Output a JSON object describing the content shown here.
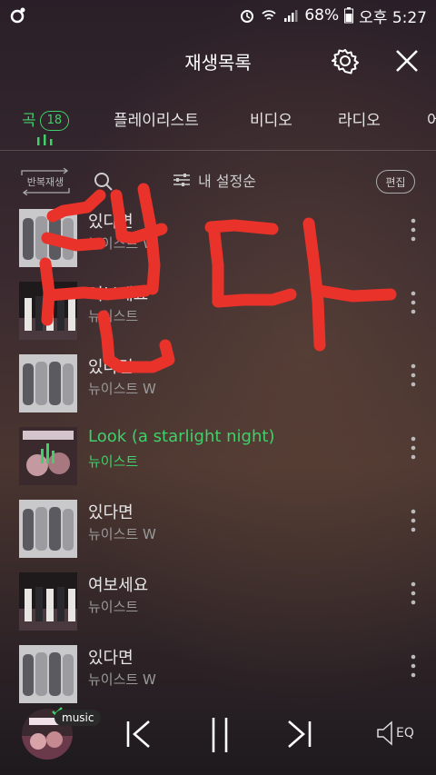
{
  "status_bar": {
    "battery_percent": "68%",
    "time": "오후 5:27"
  },
  "header": {
    "title": "재생목록"
  },
  "tabs": [
    {
      "label": "곡",
      "badge": "18",
      "active": true
    },
    {
      "label": "플레이리스트",
      "active": false
    },
    {
      "label": "비디오",
      "active": false
    },
    {
      "label": "라디오",
      "active": false
    },
    {
      "label": "어",
      "active": false
    }
  ],
  "toolbar": {
    "repeat_label": "반복재생",
    "sort_label": "내 설정순",
    "edit_label": "편집"
  },
  "songs": [
    {
      "title": "있다면",
      "artist": "뉴이스트 W",
      "playing": false
    },
    {
      "title": "여보세요",
      "artist": "뉴이스트",
      "playing": false
    },
    {
      "title": "있다면",
      "artist": "뉴이스트 W",
      "playing": false
    },
    {
      "title": "Look (a starlight night)",
      "artist": "뉴이스트",
      "playing": true
    },
    {
      "title": "있다면",
      "artist": "뉴이스트 W",
      "playing": false
    },
    {
      "title": "여보세요",
      "artist": "뉴이스트",
      "playing": false
    },
    {
      "title": "있다면",
      "artist": "뉴이스트 W",
      "playing": false
    }
  ],
  "player": {
    "source_tag": "music",
    "eq_label": "EQ"
  },
  "colors": {
    "accent": "#3fd06a",
    "scribble": "#e8322a"
  },
  "icons": [
    "settings-icon",
    "close-icon",
    "search-icon",
    "sort-icon",
    "more-icon",
    "previous-icon",
    "pause-icon",
    "next-icon",
    "eq-speaker-icon"
  ]
}
